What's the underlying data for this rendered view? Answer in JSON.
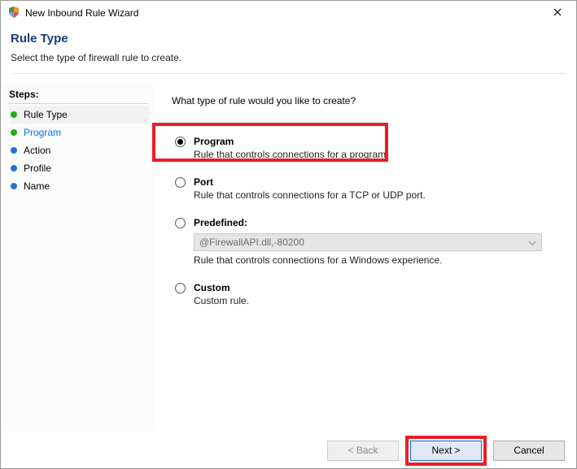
{
  "window": {
    "title": "New Inbound Rule Wizard"
  },
  "header": {
    "title": "Rule Type",
    "description": "Select the type of firewall rule to create."
  },
  "sidebar": {
    "title": "Steps:",
    "items": [
      {
        "label": "Rule Type"
      },
      {
        "label": "Program"
      },
      {
        "label": "Action"
      },
      {
        "label": "Profile"
      },
      {
        "label": "Name"
      }
    ]
  },
  "content": {
    "question": "What type of rule would you like to create?",
    "options": {
      "program": {
        "label": "Program",
        "description": "Rule that controls connections for a program."
      },
      "port": {
        "label": "Port",
        "description": "Rule that controls connections for a TCP or UDP port."
      },
      "predefined": {
        "label": "Predefined:",
        "comboValue": "@FirewallAPI.dll,-80200",
        "description": "Rule that controls connections for a Windows experience."
      },
      "custom": {
        "label": "Custom",
        "description": "Custom rule."
      }
    }
  },
  "buttons": {
    "back": "< Back",
    "next": "Next >",
    "cancel": "Cancel"
  }
}
